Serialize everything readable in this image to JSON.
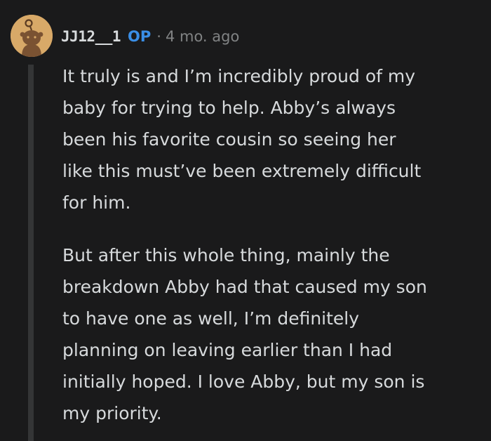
{
  "comment": {
    "username": "JJ12__1",
    "op_badge": "OP",
    "separator": "·",
    "timestamp": "4 mo. ago",
    "paragraphs": [
      {
        "lines": [
          "It truly is and I’m incredibly proud of my",
          "baby for trying to help. Abby’s always",
          "been his favorite cousin so seeing her",
          "like this must’ve been extremely difficult",
          "for him."
        ]
      },
      {
        "lines": [
          "But after this whole thing, mainly the",
          "breakdown Abby had that caused my son",
          "to have one as well, I’m definitely",
          "planning on leaving earlier than I had",
          "initially hoped. I love Abby, but my son is",
          "my priority."
        ]
      }
    ]
  },
  "colors": {
    "background": "#1a1a1b",
    "text": "#d7dadc",
    "muted": "#818384",
    "op": "#3a8ee6",
    "avatar_bg": "#d8a968",
    "thread_line": "#343536"
  },
  "icons": {
    "avatar": "snoo-avatar-icon"
  }
}
